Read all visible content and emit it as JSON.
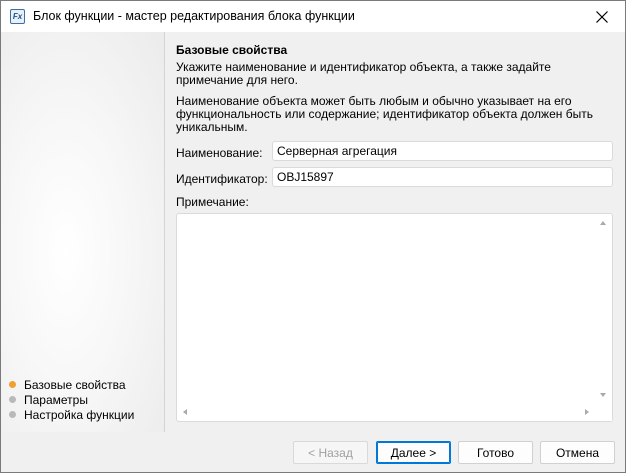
{
  "window": {
    "title": "Блок функции - мастер редактирования блока функции",
    "icon": "fx-icon",
    "icon_glyph": "Fx"
  },
  "sidebar": {
    "steps": [
      {
        "label": "Базовые свойства",
        "active": true
      },
      {
        "label": "Параметры",
        "active": false
      },
      {
        "label": "Настройка функции",
        "active": false
      }
    ]
  },
  "content": {
    "section_title": "Базовые свойства",
    "description_1": "Укажите наименование и идентификатор объекта, а также задайте примечание для него.",
    "description_2": "Наименование объекта может быть любым и обычно указывает на его функциональность или содержание; идентификатор объекта должен быть уникальным.",
    "name_label": "Наименование:",
    "name_value": "Серверная агрегация",
    "id_label": "Идентификатор:",
    "id_value": "OBJ15897",
    "note_label": "Примечание:",
    "note_value": ""
  },
  "footer": {
    "back_label": "< Назад",
    "next_label": "Далее >",
    "finish_label": "Готово",
    "cancel_label": "Отмена"
  },
  "colors": {
    "active_step": "#f0a030",
    "inactive_step": "#b9b9b9",
    "focus_border": "#0078d7"
  }
}
